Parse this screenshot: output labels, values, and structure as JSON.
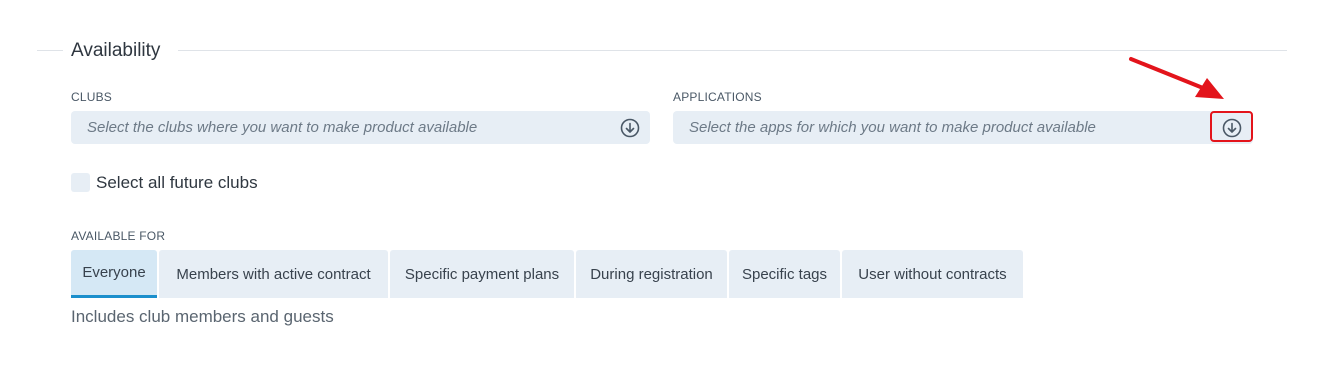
{
  "section": {
    "title": "Availability"
  },
  "clubs": {
    "label": "CLUBS",
    "placeholder": "Select the clubs where you want to make product available",
    "dropdown_icon": "chevron-down-circle-icon"
  },
  "applications": {
    "label": "APPLICATIONS",
    "placeholder": "Select the apps for which you want to make product available",
    "dropdown_icon": "chevron-down-circle-icon"
  },
  "future_clubs": {
    "label": "Select all future clubs",
    "checked": false
  },
  "available_for": {
    "label": "AVAILABLE FOR",
    "tabs": [
      {
        "label": "Everyone",
        "active": true
      },
      {
        "label": "Members with active contract",
        "active": false
      },
      {
        "label": "Specific payment plans",
        "active": false
      },
      {
        "label": "During registration",
        "active": false
      },
      {
        "label": "Specific tags",
        "active": false
      },
      {
        "label": "User without contracts",
        "active": false
      }
    ],
    "helper": "Includes club members and guests"
  },
  "colors": {
    "accent": "#1b8fcc",
    "field_bg": "#e7eef5",
    "annotation_red": "#e3141b"
  }
}
